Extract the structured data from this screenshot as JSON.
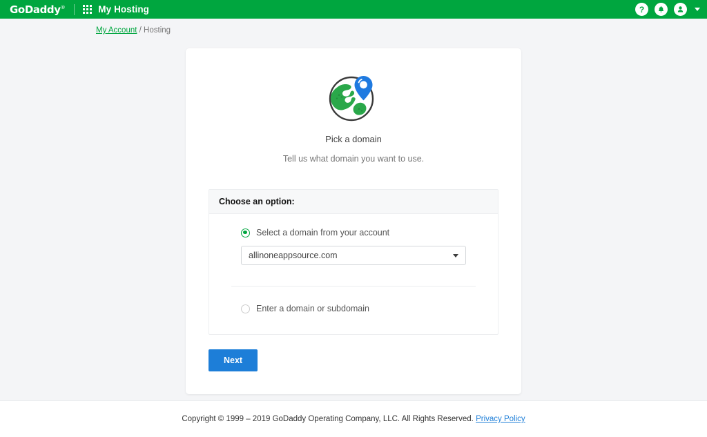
{
  "header": {
    "brand": "GoDaddy",
    "brand_trademark": "®",
    "waffle_icon": "apps-grid-icon",
    "app_title": "My Hosting",
    "help_icon": "help-question-icon",
    "notifications_icon": "bell-icon",
    "account_icon": "user-avatar-icon",
    "account_caret_icon": "chevron-down-icon",
    "background_color": "#00a63f"
  },
  "breadcrumb": {
    "link_label": "My Account",
    "separator": "/",
    "current": "Hosting"
  },
  "hero": {
    "illustration_name": "globe-with-map-pin-icon",
    "title": "Pick a domain",
    "subtitle": "Tell us what domain you want to use."
  },
  "panel": {
    "heading": "Choose an option:",
    "options": [
      {
        "label": "Select a domain from your account",
        "selected": true,
        "radio_name": "radio-select-existing-domain"
      },
      {
        "label": "Enter a domain or subdomain",
        "selected": false,
        "radio_name": "radio-enter-domain"
      }
    ],
    "domain_select": {
      "value": "allinoneappsource.com",
      "caret_icon": "chevron-down-icon"
    }
  },
  "actions": {
    "next_label": "Next",
    "next_color": "#1d7ed8"
  },
  "footer": {
    "copyright": "Copyright © 1999 – 2019 GoDaddy Operating Company, LLC. All Rights Reserved.",
    "privacy_label": "Privacy Policy"
  }
}
